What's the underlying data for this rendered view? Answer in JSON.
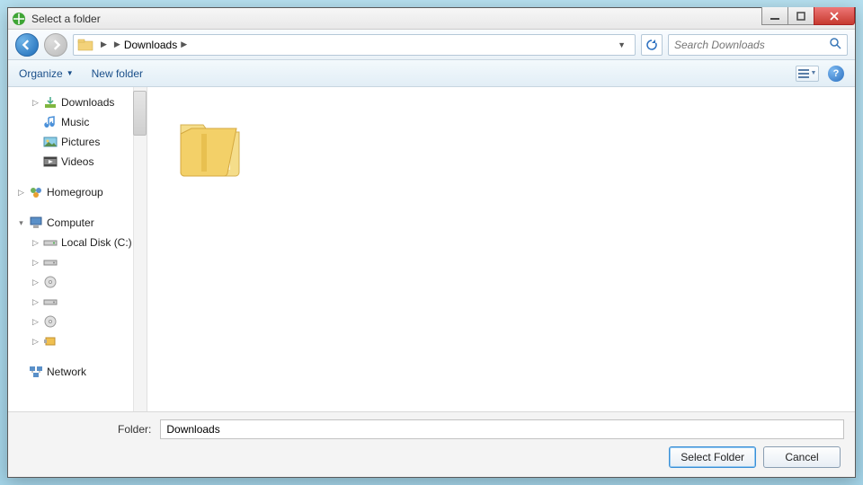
{
  "window": {
    "title": "Select a folder"
  },
  "breadcrumb": {
    "segment1": "",
    "segment2": "Downloads"
  },
  "search": {
    "placeholder": "Search Downloads"
  },
  "toolbar": {
    "organize": "Organize",
    "new_folder": "New folder"
  },
  "tree": {
    "libraries": [
      {
        "label": "Downloads"
      },
      {
        "label": "Music"
      },
      {
        "label": "Pictures"
      },
      {
        "label": "Videos"
      }
    ],
    "homegroup": "Homegroup",
    "computer": "Computer",
    "local_disk": "Local Disk (C:)",
    "network": "Network"
  },
  "footer": {
    "folder_label": "Folder:",
    "folder_value": "Downloads",
    "select_btn": "Select Folder",
    "cancel_btn": "Cancel"
  }
}
